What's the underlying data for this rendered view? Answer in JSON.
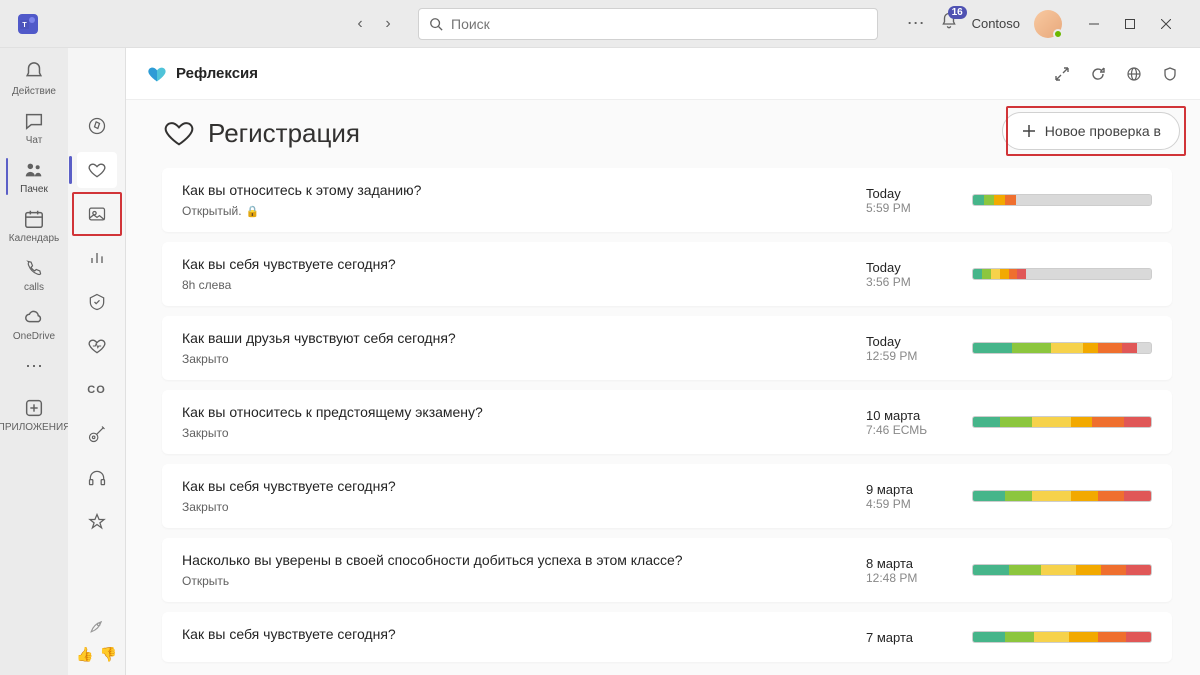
{
  "titlebar": {
    "search_placeholder": "Поиск",
    "notification_count": "16",
    "tenant": "Contoso"
  },
  "app_rail": {
    "items": [
      {
        "icon": "bell",
        "label": "Действие"
      },
      {
        "icon": "chat",
        "label": "Чат"
      },
      {
        "icon": "teams",
        "label": "Пачек",
        "active": true
      },
      {
        "icon": "calendar",
        "label": "Календарь"
      },
      {
        "icon": "calls",
        "label": "calls"
      },
      {
        "icon": "onedrive",
        "label": "OneDrive"
      },
      {
        "icon": "more",
        "label": ""
      }
    ],
    "apps_label": "ПРИЛОЖЕНИЯ"
  },
  "sec_rail": {
    "items": [
      {
        "icon": "compass"
      },
      {
        "icon": "heart",
        "selected": true
      },
      {
        "icon": "photo"
      },
      {
        "icon": "chart"
      },
      {
        "icon": "badge"
      },
      {
        "icon": "pulse"
      },
      {
        "label": "CO"
      },
      {
        "icon": "guitar"
      },
      {
        "icon": "headphones"
      },
      {
        "icon": "star"
      },
      {
        "icon": "blue-app"
      }
    ]
  },
  "header": {
    "title": "Рефлексия"
  },
  "page": {
    "title": "Регистрация",
    "new_button": "Новое проверка в"
  },
  "checkins": [
    {
      "question": "Как вы относитесь к этому заданию?",
      "status": "Открытый.",
      "has_lock": true,
      "date": "Today",
      "time": "5:59 PM",
      "segments": [
        {
          "c": "#46b58a",
          "w": 6
        },
        {
          "c": "#8cc63e",
          "w": 6
        },
        {
          "c": "#f2a900",
          "w": 6
        },
        {
          "c": "#ef6f2e",
          "w": 6
        },
        {
          "c": "#d9d9d9",
          "w": 76
        }
      ]
    },
    {
      "question": "Как вы себя чувствуете сегодня?",
      "status": "8h слева",
      "date": "Today",
      "time": "3:56 PM",
      "segments": [
        {
          "c": "#46b58a",
          "w": 5
        },
        {
          "c": "#8cc63e",
          "w": 5
        },
        {
          "c": "#f6d24b",
          "w": 5
        },
        {
          "c": "#f2a900",
          "w": 5
        },
        {
          "c": "#ef6f2e",
          "w": 5
        },
        {
          "c": "#e05757",
          "w": 5
        },
        {
          "c": "#d9d9d9",
          "w": 70
        }
      ]
    },
    {
      "question": "Как ваши друзья чувствуют себя сегодня?",
      "status": "Закрыто",
      "date": "Today",
      "time": "12:59 PM",
      "segments": [
        {
          "c": "#46b58a",
          "w": 22
        },
        {
          "c": "#8cc63e",
          "w": 22
        },
        {
          "c": "#f6d24b",
          "w": 18
        },
        {
          "c": "#f2a900",
          "w": 8
        },
        {
          "c": "#ef6f2e",
          "w": 14
        },
        {
          "c": "#e05757",
          "w": 8
        },
        {
          "c": "#d9d9d9",
          "w": 8
        }
      ]
    },
    {
      "question": "Как вы относитесь к предстоящему экзамену?",
      "status": "Закрыто",
      "date": "10 марта",
      "time": "7:46 ЕСМЬ",
      "segments": [
        {
          "c": "#46b58a",
          "w": 15
        },
        {
          "c": "#8cc63e",
          "w": 18
        },
        {
          "c": "#f6d24b",
          "w": 22
        },
        {
          "c": "#f2a900",
          "w": 12
        },
        {
          "c": "#ef6f2e",
          "w": 18
        },
        {
          "c": "#e05757",
          "w": 15
        }
      ]
    },
    {
      "question": "Как вы себя чувствуете сегодня?",
      "status": "Закрыто",
      "date": "9 марта",
      "time": "4:59 PM",
      "segments": [
        {
          "c": "#46b58a",
          "w": 18
        },
        {
          "c": "#8cc63e",
          "w": 15
        },
        {
          "c": "#f6d24b",
          "w": 22
        },
        {
          "c": "#f2a900",
          "w": 15
        },
        {
          "c": "#ef6f2e",
          "w": 15
        },
        {
          "c": "#e05757",
          "w": 15
        }
      ]
    },
    {
      "question": "Насколько вы уверены в своей способности добиться успеха в этом классе?",
      "status": "Открыть",
      "date": "8 марта",
      "time": "12:48 PM",
      "segments": [
        {
          "c": "#46b58a",
          "w": 20
        },
        {
          "c": "#8cc63e",
          "w": 18
        },
        {
          "c": "#f6d24b",
          "w": 20
        },
        {
          "c": "#f2a900",
          "w": 14
        },
        {
          "c": "#ef6f2e",
          "w": 14
        },
        {
          "c": "#e05757",
          "w": 14
        }
      ]
    },
    {
      "question": "Как вы себя чувствуете сегодня?",
      "status": "",
      "date": "7 марта",
      "time": "",
      "segments": [
        {
          "c": "#46b58a",
          "w": 18
        },
        {
          "c": "#8cc63e",
          "w": 16
        },
        {
          "c": "#f6d24b",
          "w": 20
        },
        {
          "c": "#f2a900",
          "w": 16
        },
        {
          "c": "#ef6f2e",
          "w": 16
        },
        {
          "c": "#e05757",
          "w": 14
        }
      ]
    }
  ]
}
